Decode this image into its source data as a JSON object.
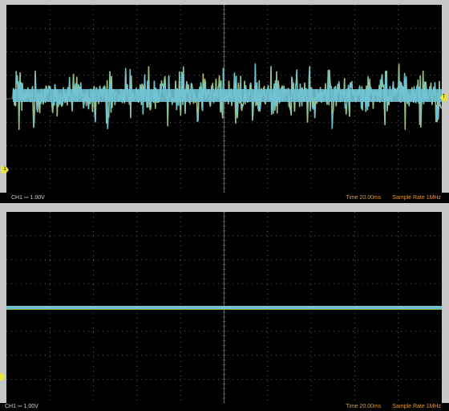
{
  "top": {
    "channel_label": "CH1 ⎓ 1.00V",
    "time_label": "Time 20.00ms",
    "sample_rate_label": "Sample Rate 1MHz",
    "ch_marker": "1",
    "trig_marker": "T"
  },
  "bottom": {
    "channel_label": "CH1 ⎓ 1.00V",
    "time_label": "Time 20.00ms",
    "sample_rate_label": "Sample Rate 1MHz"
  },
  "colors": {
    "trace": "#6fc1d4",
    "trace_edge": "#c9d23a",
    "grid": "#7a7a7a",
    "marker": "#e8e43a",
    "status_text": "#e09a3c"
  }
}
